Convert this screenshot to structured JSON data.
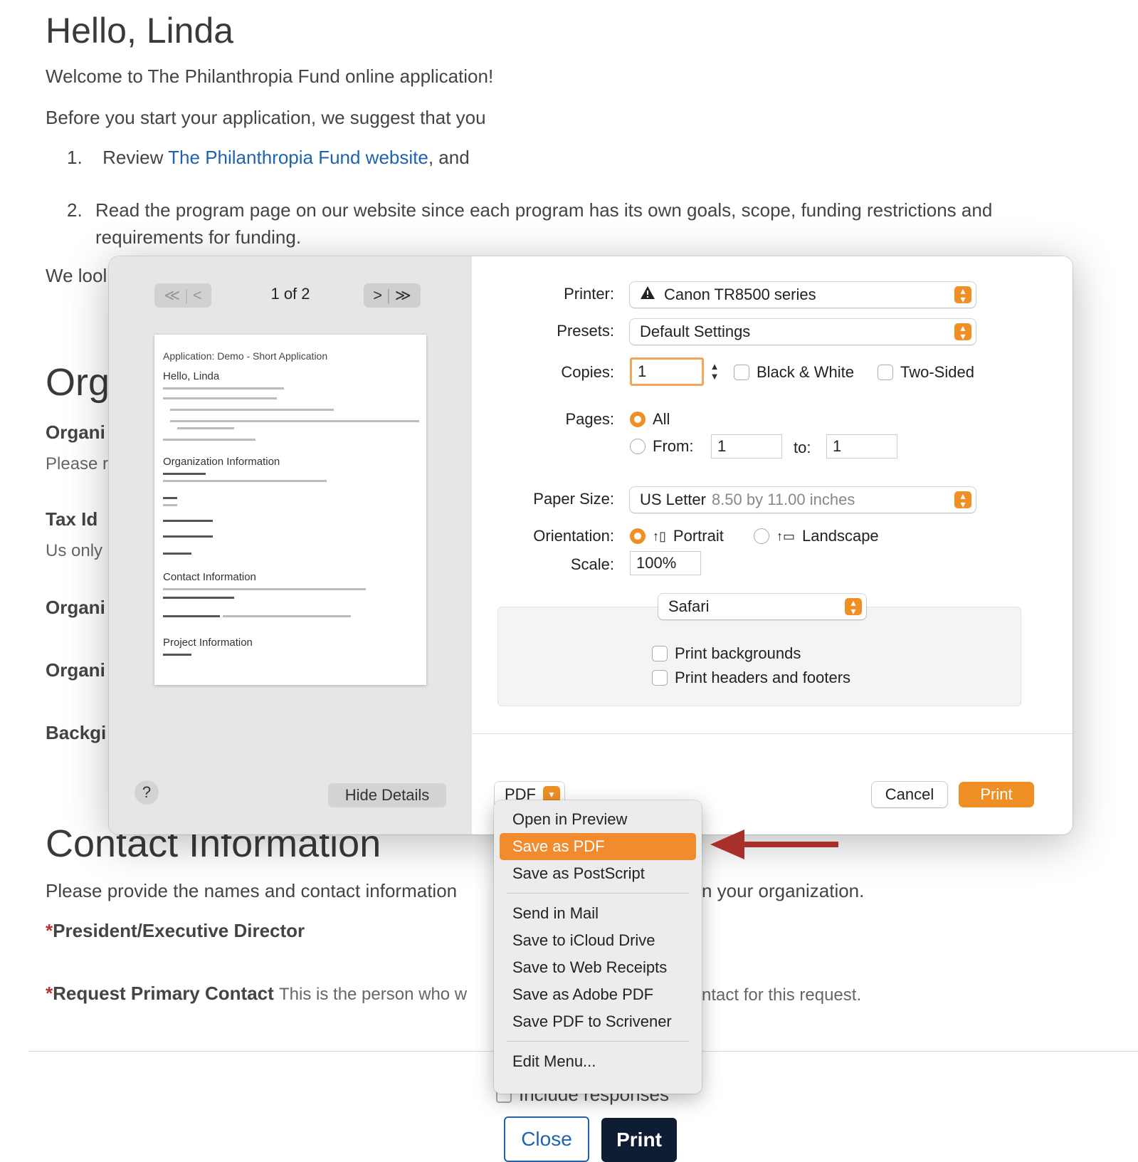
{
  "page": {
    "greeting": "Hello, Linda",
    "welcome": "Welcome to The Philanthropia Fund online application!",
    "intro": "Before you start your application, we suggest that you",
    "steps": [
      {
        "num": "1.",
        "pre": "Review ",
        "link": "The Philanthropia Fund website",
        "post": ", and"
      },
      {
        "num": "2.",
        "line1": "Read the program page on our website since each program has its own goals, scope, funding restrictions and",
        "line2": "requirements for funding."
      }
    ],
    "look_forward_fragment": "We lool",
    "org_section_fragment": "Org",
    "org_name_fragment": "Organi",
    "please_fragment": "Please r",
    "tax_id": "Tax Id",
    "us_only": "Us only",
    "org_website_fragment": "Organi",
    "org_mission_fragment": "Organi",
    "background_fragment": "Backgi",
    "contact_heading": "Contact Information",
    "contact_desc_left": "Please provide the names and contact information",
    "contact_desc_right": "n your organization.",
    "president_label": "President/Executive Director",
    "primary_contact_label": "Request Primary Contact",
    "primary_contact_desc_left": "This is the person who w",
    "primary_contact_desc_right": "ntact for this request.",
    "required_mark": "*",
    "include_responses": "Include responses",
    "close_button": "Close",
    "print_button": "Print"
  },
  "dialog": {
    "page_counter": "1 of 2",
    "nav_first": "≪",
    "nav_prev": "<",
    "nav_next": ">",
    "nav_last": "≫",
    "help": "?",
    "hide_details": "Hide Details",
    "thumbnail": {
      "title": "Application: Demo - Short Application",
      "greeting": "Hello, Linda",
      "sections": [
        "Organization Information",
        "Contact Information",
        "Project Information"
      ]
    },
    "printer_label": "Printer:",
    "printer_value": "Canon TR8500 series",
    "printer_warning_icon": "warning-icon",
    "presets_label": "Presets:",
    "presets_value": "Default Settings",
    "copies_label": "Copies:",
    "copies_value": "1",
    "black_white": "Black & White",
    "two_sided": "Two-Sided",
    "pages_label": "Pages:",
    "pages_all": "All",
    "pages_from": "From:",
    "pages_from_value": "1",
    "pages_to": "to:",
    "pages_to_value": "1",
    "paper_label": "Paper Size:",
    "paper_value": "US Letter",
    "paper_dims": "8.50 by 11.00 inches",
    "orientation_label": "Orientation:",
    "portrait": "Portrait",
    "landscape": "Landscape",
    "scale_label": "Scale:",
    "scale_value": "100%",
    "app_section": "Safari",
    "print_backgrounds": "Print backgrounds",
    "print_headers": "Print headers and footers",
    "pdf_button": "PDF",
    "cancel": "Cancel",
    "print": "Print",
    "accent": "#f08f26"
  },
  "pdf_menu": {
    "items": [
      "Open in Preview",
      "Save as PDF",
      "Save as PostScript",
      "Send in Mail",
      "Save to iCloud Drive",
      "Save to Web Receipts",
      "Save as Adobe PDF",
      "Save PDF to Scrivener",
      "Edit Menu..."
    ],
    "selected": "Save as PDF",
    "selected_color": "#f28a2e"
  },
  "annotation": {
    "arrow_color": "#a8302a"
  }
}
